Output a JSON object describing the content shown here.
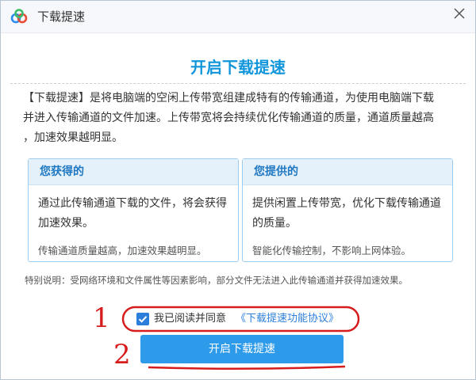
{
  "window": {
    "title": "下载提速",
    "close_icon": "close-icon",
    "logo_icon": "cloud-logo-icon"
  },
  "main": {
    "heading": "开启下载提速",
    "intro": "【下载提速】是将电脑端的空闲上传带宽组建成特有的传输通道，为使用电脑端下载\n并进入传输通道的文件加速。上传带宽将会持续优化传输通道的质量，通道质量越高\n，加速效果越明显。"
  },
  "cards": [
    {
      "title": "您获得的",
      "main_text": "通过此传输通道下载的文件，将会获得加速效果。",
      "sub_text": "传输通道质量越高，加速效果越明显。"
    },
    {
      "title": "您提供的",
      "main_text": "提供闲置上传带宽，优化下载传输通道的质量。",
      "sub_text": "智能化传输控制，不影响上网体验。"
    }
  ],
  "note": "特别说明：受网络环境和文件属性等因素影响，部分文件无法进入此传输通道并获得加速效果。",
  "agreement": {
    "checked": true,
    "text": "我已阅读并同意",
    "link": "《下载提速功能协议》"
  },
  "primary_button": "开启下载提速",
  "annotations": {
    "marker_1": "1",
    "marker_2": "2",
    "color": "#d61c1c"
  },
  "colors": {
    "accent": "#1296db",
    "button": "#2e9bea",
    "link": "#2b7fdb",
    "card_border": "#9ecdf0",
    "card_header_bg": "#e4f1fb"
  }
}
